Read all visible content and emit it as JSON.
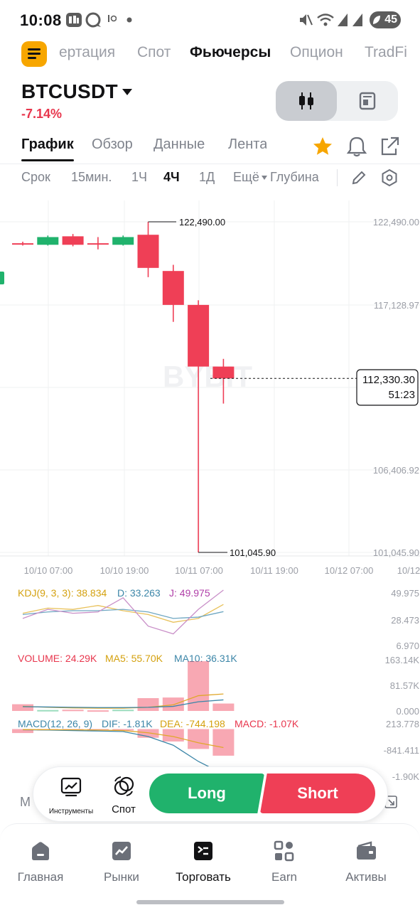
{
  "status_bar": {
    "time": "10:08",
    "battery": "45",
    "notification_icons": [
      "gallery-icon",
      "bubble-icon",
      "io-icon",
      "dot-icon"
    ],
    "right_icons": [
      "mute-icon",
      "wifi-icon",
      "signal-icon",
      "signal-icon"
    ]
  },
  "top_tabs": [
    {
      "label": "ертация",
      "active": false
    },
    {
      "label": "Спот",
      "active": false
    },
    {
      "label": "Фьючерсы",
      "active": true
    },
    {
      "label": "Опцион",
      "active": false
    },
    {
      "label": "TradFi",
      "active": false
    }
  ],
  "header": {
    "symbol": "BTCUSDT",
    "change": "-7.14%"
  },
  "sub_tabs": [
    {
      "label": "График",
      "active": true
    },
    {
      "label": "Обзор",
      "active": false
    },
    {
      "label": "Данные",
      "active": false
    },
    {
      "label": "Лента",
      "active": false
    }
  ],
  "intervals": [
    {
      "label": "Срок",
      "active": false
    },
    {
      "label": "15мин.",
      "active": false
    },
    {
      "label": "1Ч",
      "active": false
    },
    {
      "label": "4Ч",
      "active": true
    },
    {
      "label": "1Д",
      "active": false
    },
    {
      "label": "Ещё",
      "active": false
    },
    {
      "label": "Глубина",
      "active": false
    }
  ],
  "chart_data": {
    "type": "candlestick",
    "watermark": "BYBIT",
    "price_axis": [
      "122,490.00",
      "117,128.97",
      "106,406.92",
      "101,045.90"
    ],
    "time_axis": [
      "10/10 07:00",
      "10/10 19:00",
      "10/11 07:00",
      "10/11 19:00",
      "10/12 07:00",
      "10/12"
    ],
    "ylim": [
      101045.9,
      122490.0
    ],
    "high_label": "122,490.00",
    "low_label": "101,045.90",
    "last_price": "112,330.30",
    "countdown": "51:23",
    "colors": {
      "up": "#20b26c",
      "down": "#ef3f56"
    },
    "candles": [
      {
        "open": 121100,
        "high": 121200,
        "low": 120950,
        "close": 121050
      },
      {
        "open": 121000,
        "high": 121600,
        "low": 120950,
        "close": 121500
      },
      {
        "open": 121550,
        "high": 121700,
        "low": 120900,
        "close": 121000
      },
      {
        "open": 121100,
        "high": 121500,
        "low": 120700,
        "close": 121050
      },
      {
        "open": 121000,
        "high": 121600,
        "low": 120950,
        "close": 121500
      },
      {
        "open": 121650,
        "high": 122490,
        "low": 118900,
        "close": 119500
      },
      {
        "open": 119300,
        "high": 119700,
        "low": 116000,
        "close": 117100
      },
      {
        "open": 117100,
        "high": 117400,
        "low": 101046,
        "close": 113100
      },
      {
        "open": 113100,
        "high": 113600,
        "low": 110700,
        "close": 112330
      }
    ],
    "kdj": {
      "label": "KDJ(9, 3, 3): 38.834",
      "d_label": "D: 33.263",
      "j_label": "J: 49.975",
      "axis": [
        "49.975",
        "28.473",
        "6.970"
      ],
      "ylim": [
        6.97,
        49.975
      ],
      "k": [
        32,
        36,
        35,
        38,
        34,
        31,
        25,
        28,
        38.834
      ],
      "d": [
        31,
        33,
        34,
        34,
        35,
        33,
        28,
        29,
        33.263
      ],
      "j": [
        28,
        35,
        32,
        33,
        44,
        22,
        16,
        35,
        49.975
      ]
    },
    "volume": {
      "label": "VOLUME: 24.29K",
      "ma5_label": "MA5: 55.70K",
      "ma10_label": "MA10: 36.31K",
      "axis": [
        "163.14K",
        "81.57K",
        "0.000"
      ],
      "ylim": [
        0,
        163.14
      ],
      "values": [
        22,
        3,
        4,
        2,
        4,
        42,
        44,
        163,
        24.29
      ],
      "ma5": [
        15,
        12,
        10,
        9,
        9,
        12,
        20,
        50,
        55.7
      ],
      "ma10": [
        14,
        13,
        12,
        11,
        11,
        12,
        15,
        30,
        36.31
      ]
    },
    "macd": {
      "label": "MACD(12, 26, 9)",
      "dif_label": "DIF: -1.81K",
      "dea_label": "DEA: -744.198",
      "macd_label": "MACD: -1.07K",
      "axis": [
        "213.778",
        "-841.411",
        "-1.90K"
      ],
      "ylim": [
        -1900,
        213.778
      ],
      "hist": [
        -160,
        -40,
        -30,
        -50,
        -60,
        -350,
        -500,
        -800,
        -1070
      ],
      "dif": [
        -30,
        -40,
        -60,
        -80,
        -100,
        -300,
        -650,
        -1300,
        -1810
      ],
      "dea": [
        -20,
        -25,
        -30,
        -40,
        -60,
        -150,
        -300,
        -550,
        -744.198
      ]
    }
  },
  "trade_bar": {
    "tools_label": "Инструменты",
    "spot_label": "Спот",
    "long_label": "Long",
    "short_label": "Short"
  },
  "peek_text": "M",
  "bottom_nav": [
    {
      "label": "Главная",
      "icon": "home-icon",
      "active": false
    },
    {
      "label": "Рынки",
      "icon": "markets-chart-icon",
      "active": false
    },
    {
      "label": "Торговать",
      "icon": "trade-icon",
      "active": true
    },
    {
      "label": "Earn",
      "icon": "earn-icon",
      "active": false
    },
    {
      "label": "Активы",
      "icon": "wallet-icon",
      "active": false
    }
  ]
}
